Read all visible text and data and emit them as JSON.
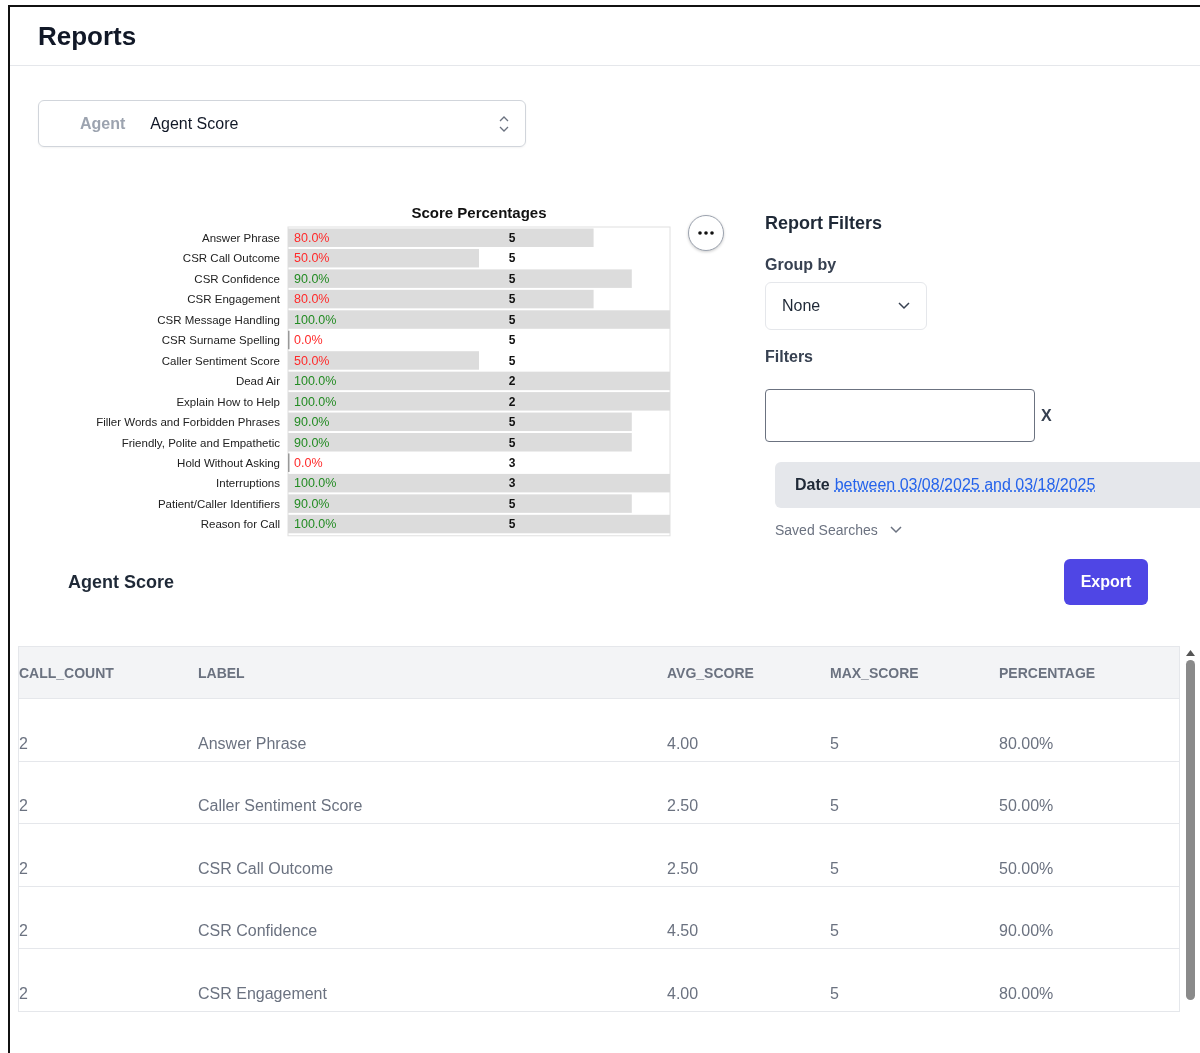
{
  "page": {
    "title": "Reports"
  },
  "report_select": {
    "category": "Agent",
    "value": "Agent Score"
  },
  "chart": {
    "chart_data": {
      "type": "bar",
      "orientation": "horizontal",
      "title": "Score Percentages",
      "categories": [
        "Answer Phrase",
        "CSR Call Outcome",
        "CSR Confidence",
        "CSR Engagement",
        "CSR Message Handling",
        "CSR Surname Spelling",
        "Caller Sentiment Score",
        "Dead Air",
        "Explain How to Help",
        "Filler Words and Forbidden Phrases",
        "Friendly, Polite and Empathetic",
        "Hold Without Asking",
        "Interruptions",
        "Patient/Caller Identifiers",
        "Reason for Call"
      ],
      "values": [
        80,
        50,
        90,
        80,
        100,
        0,
        50,
        100,
        100,
        90,
        90,
        0,
        100,
        90,
        100
      ],
      "xlim": [
        0,
        100
      ],
      "value_labels": [
        "80.0%",
        "50.0%",
        "90.0%",
        "80.0%",
        "100.0%",
        "0.0%",
        "50.0%",
        "100.0%",
        "100.0%",
        "90.0%",
        "90.0%",
        "0.0%",
        "100.0%",
        "90.0%",
        "100.0%"
      ],
      "annotations": [
        "5",
        "5",
        "5",
        "5",
        "5",
        "5",
        "5",
        "2",
        "2",
        "5",
        "5",
        "3",
        "3",
        "5",
        "5"
      ]
    }
  },
  "filters": {
    "title": "Report Filters",
    "group_by_label": "Group by",
    "group_by_value": "None",
    "filters_label": "Filters",
    "clear": "X",
    "date_label": "Date",
    "date_value": "between 03/08/2025 and 03/18/2025",
    "saved_searches": "Saved Searches"
  },
  "table_section": {
    "title": "Agent Score",
    "export": "Export"
  },
  "table": {
    "columns": [
      "CALL_COUNT",
      "LABEL",
      "AVG_SCORE",
      "MAX_SCORE",
      "PERCENTAGE"
    ],
    "rows": [
      [
        "2",
        "Answer Phrase",
        "4.00",
        "5",
        "80.00%"
      ],
      [
        "2",
        "Caller Sentiment Score",
        "2.50",
        "5",
        "50.00%"
      ],
      [
        "2",
        "CSR Call Outcome",
        "2.50",
        "5",
        "50.00%"
      ],
      [
        "2",
        "CSR Confidence",
        "4.50",
        "5",
        "90.00%"
      ],
      [
        "2",
        "CSR Engagement",
        "4.00",
        "5",
        "80.00%"
      ]
    ]
  }
}
